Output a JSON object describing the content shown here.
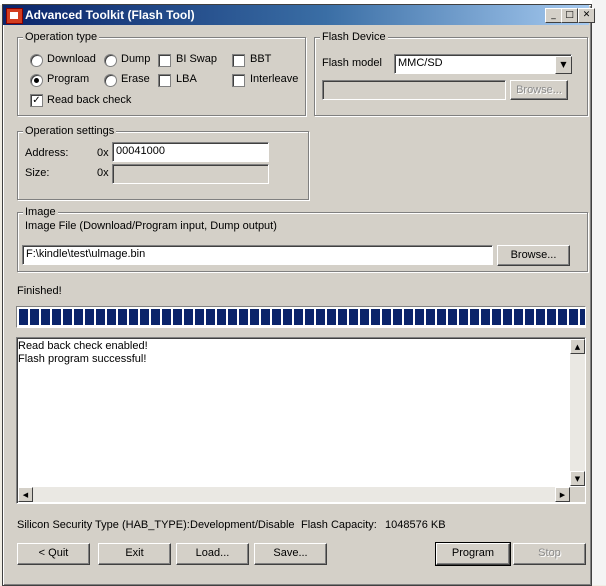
{
  "window": {
    "title": "Advanced Toolkit (Flash Tool)",
    "controls": {
      "minimize": "_",
      "maximize": "□",
      "close": "✕"
    }
  },
  "operation_type": {
    "legend": "Operation type",
    "options": {
      "download": "Download",
      "dump": "Dump",
      "bi_swap": "BI Swap",
      "bbt": "BBT",
      "program": "Program",
      "erase": "Erase",
      "lba": "LBA",
      "interleave": "Interleave",
      "read_back_check": "Read back check"
    },
    "selected": "Program",
    "read_back_checked": true
  },
  "flash_device": {
    "legend": "Flash Device",
    "model_label": "Flash model",
    "model_value": "MMC/SD",
    "browse_label": "Browse..."
  },
  "operation_settings": {
    "legend": "Operation settings",
    "address_label": "Address:",
    "address_prefix": "0x",
    "address_value": "00041000",
    "size_label": "Size:",
    "size_prefix": "0x",
    "size_value": ""
  },
  "image": {
    "legend": "Image",
    "description": "Image File (Download/Program input, Dump output)",
    "path": "F:\\kindle\\test\\ulmage.bin",
    "browse_label": "Browse..."
  },
  "status": {
    "text": "Finished!",
    "progress": 1.0
  },
  "log": {
    "lines": "Read back check enabled!\nFlash program successful!"
  },
  "footer": {
    "security_label": "Silicon Security Type (HAB_TYPE):",
    "security_value": "Development/Disable",
    "capacity_label": "Flash Capacity:",
    "capacity_value": "1048576 KB"
  },
  "buttons": {
    "quit": "< Quit",
    "exit": "Exit",
    "load": "Load...",
    "save": "Save...",
    "program": "Program",
    "stop": "Stop"
  },
  "colors": {
    "title_bar": "#0a246a",
    "progress_fill": "#0a246a",
    "dialog_face": "#d4d0c8"
  }
}
